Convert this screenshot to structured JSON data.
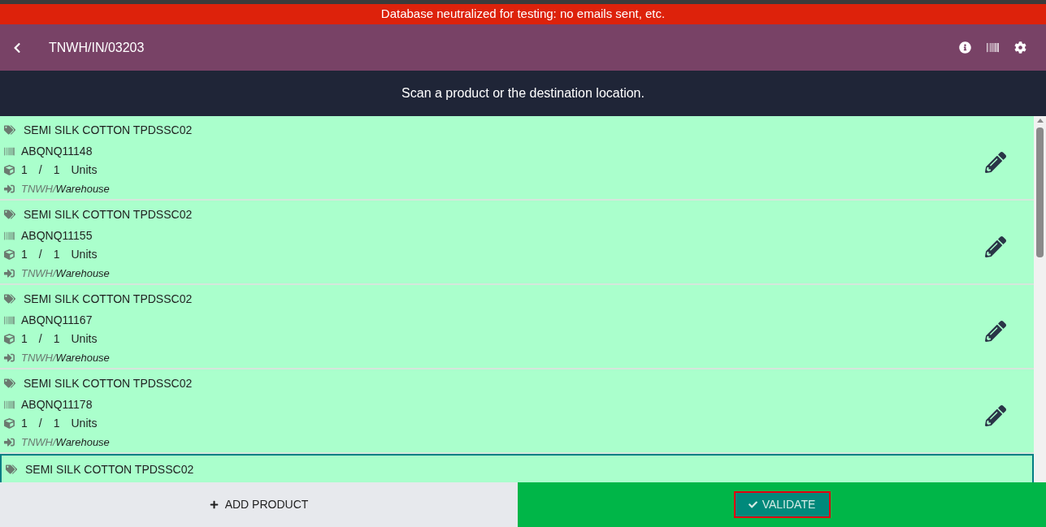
{
  "banner": "Database neutralized for testing: no emails sent, etc.",
  "header": {
    "title": "TNWH/IN/03203"
  },
  "instruction": "Scan a product or the destination location.",
  "lines": [
    {
      "product": "SEMI SILK COTTON TPDSSC02",
      "lot": "ABQNQ11148",
      "qty_done": "1",
      "separator": "/",
      "qty_demand": "1",
      "uom": "Units",
      "location_parent": "TNWH/",
      "location": "Warehouse",
      "selected": false
    },
    {
      "product": "SEMI SILK COTTON TPDSSC02",
      "lot": "ABQNQ11155",
      "qty_done": "1",
      "separator": "/",
      "qty_demand": "1",
      "uom": "Units",
      "location_parent": "TNWH/",
      "location": "Warehouse",
      "selected": false
    },
    {
      "product": "SEMI SILK COTTON TPDSSC02",
      "lot": "ABQNQ11167",
      "qty_done": "1",
      "separator": "/",
      "qty_demand": "1",
      "uom": "Units",
      "location_parent": "TNWH/",
      "location": "Warehouse",
      "selected": false
    },
    {
      "product": "SEMI SILK COTTON TPDSSC02",
      "lot": "ABQNQ11178",
      "qty_done": "1",
      "separator": "/",
      "qty_demand": "1",
      "uom": "Units",
      "location_parent": "TNWH/",
      "location": "Warehouse",
      "selected": false
    },
    {
      "product": "SEMI SILK COTTON TPDSSC02",
      "selected": true
    }
  ],
  "footer": {
    "add_product": "ADD PRODUCT",
    "validate": "VALIDATE",
    "validate_highlighted": true
  }
}
